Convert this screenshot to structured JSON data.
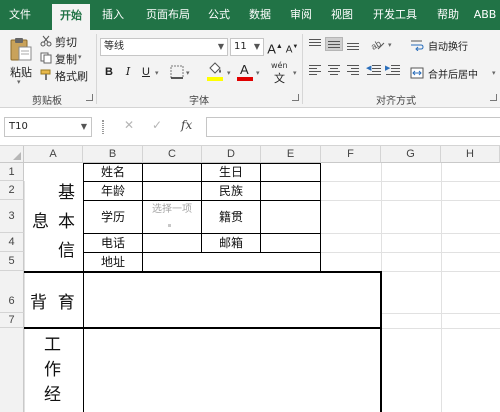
{
  "tabs": [
    "文件",
    "开始",
    "插入",
    "页面布局",
    "公式",
    "数据",
    "审阅",
    "视图",
    "开发工具",
    "帮助",
    "ABB"
  ],
  "active_tab": "开始",
  "clipboard": {
    "paste": "粘贴",
    "cut": "剪切",
    "copy": "复制",
    "format_painter": "格式刷",
    "group": "剪贴板"
  },
  "font": {
    "name": "等线",
    "size": "11",
    "bold": "B",
    "italic": "I",
    "underline": "U",
    "color_letter": "A",
    "wen": "wén",
    "group": "字体"
  },
  "alignment": {
    "wrap_text": "自动换行",
    "merge_center": "合并后居中",
    "group": "对齐方式"
  },
  "colors": {
    "excel_green": "#217346",
    "font_color": "#e00000",
    "fill_color": "#ffff00"
  },
  "formula_bar": {
    "name_box": "T10",
    "cancel": "✕",
    "enter": "✓",
    "fx": "fx",
    "formula": ""
  },
  "columns": [
    "A",
    "B",
    "C",
    "D",
    "E",
    "F",
    "G",
    "H"
  ],
  "rows": [
    "1",
    "2",
    "3",
    "4",
    "5",
    "6",
    "7"
  ],
  "form": {
    "section_basic": [
      "基",
      "息",
      "本",
      "信"
    ],
    "section_background": "背  育",
    "section_work": [
      "工",
      "作",
      "经"
    ],
    "name": "姓名",
    "age": "年龄",
    "education": "学历",
    "phone": "电话",
    "address": "地址",
    "birthday": "生日",
    "ethnicity": "民族",
    "native_place": "籍贯",
    "email": "邮箱",
    "dropdown_hint": "选择一项"
  }
}
